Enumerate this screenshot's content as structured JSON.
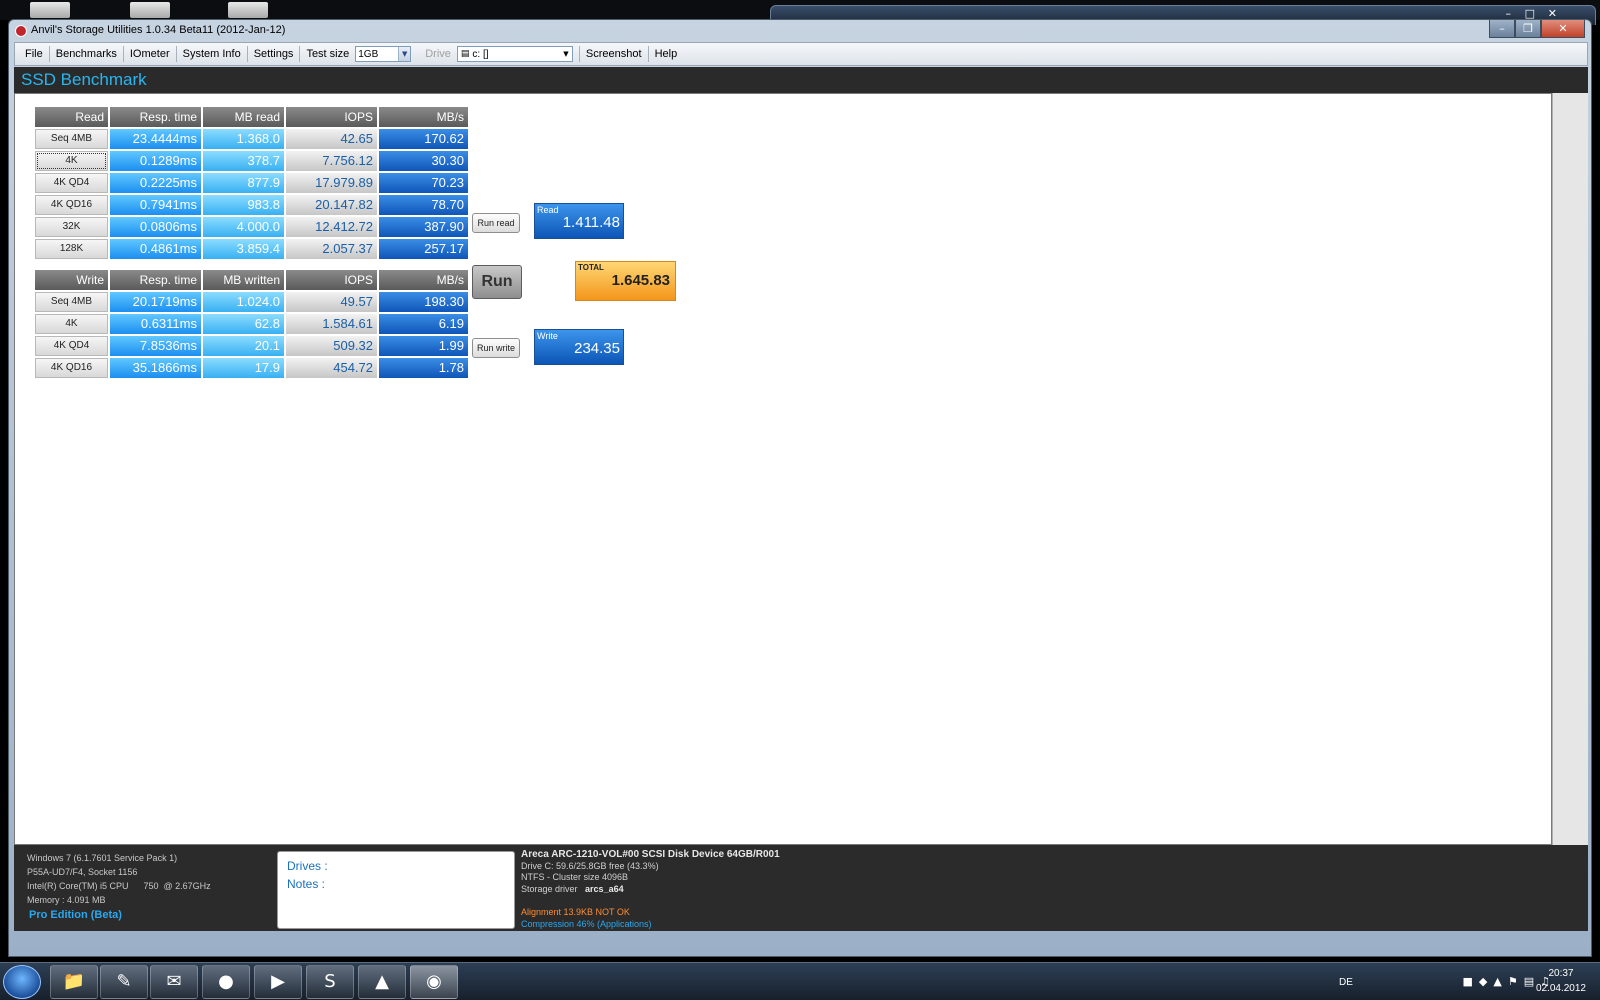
{
  "window": {
    "title": "Anvil's Storage Utilities 1.0.34 Beta11 (2012-Jan-12)"
  },
  "menu": {
    "items": [
      "File",
      "Benchmarks",
      "IOmeter",
      "System Info",
      "Settings"
    ],
    "test_size_label": "Test size",
    "test_size_value": "1GB",
    "drive_label": "Drive",
    "drive_value": "c: []",
    "screenshot": "Screenshot",
    "help": "Help"
  },
  "page_title": "SSD Benchmark",
  "read": {
    "headers": [
      "Read",
      "Resp. time",
      "MB read",
      "IOPS",
      "MB/s"
    ],
    "rows": [
      {
        "label": "Seq 4MB",
        "resp": "23.4444ms",
        "mb": "1.368.0",
        "iops": "42.65",
        "mbs": "170.62"
      },
      {
        "label": "4K",
        "resp": "0.1289ms",
        "mb": "378.7",
        "iops": "7.756.12",
        "mbs": "30.30"
      },
      {
        "label": "4K QD4",
        "resp": "0.2225ms",
        "mb": "877.9",
        "iops": "17.979.89",
        "mbs": "70.23"
      },
      {
        "label": "4K QD16",
        "resp": "0.7941ms",
        "mb": "983.8",
        "iops": "20.147.82",
        "mbs": "78.70"
      },
      {
        "label": "32K",
        "resp": "0.0806ms",
        "mb": "4.000.0",
        "iops": "12.412.72",
        "mbs": "387.90"
      },
      {
        "label": "128K",
        "resp": "0.4861ms",
        "mb": "3.859.4",
        "iops": "2.057.37",
        "mbs": "257.17"
      }
    ]
  },
  "write": {
    "headers": [
      "Write",
      "Resp. time",
      "MB written",
      "IOPS",
      "MB/s"
    ],
    "rows": [
      {
        "label": "Seq 4MB",
        "resp": "20.1719ms",
        "mb": "1.024.0",
        "iops": "49.57",
        "mbs": "198.30"
      },
      {
        "label": "4K",
        "resp": "0.6311ms",
        "mb": "62.8",
        "iops": "1.584.61",
        "mbs": "6.19"
      },
      {
        "label": "4K QD4",
        "resp": "7.8536ms",
        "mb": "20.1",
        "iops": "509.32",
        "mbs": "1.99"
      },
      {
        "label": "4K QD16",
        "resp": "35.1866ms",
        "mb": "17.9",
        "iops": "454.72",
        "mbs": "1.78"
      }
    ]
  },
  "buttons": {
    "run_read": "Run read",
    "run": "Run",
    "run_write": "Run write"
  },
  "scores": {
    "read_label": "Read",
    "read_value": "1.411.48",
    "total_label": "TOTAL",
    "total_value": "1.645.83",
    "write_label": "Write",
    "write_value": "234.35"
  },
  "system": {
    "os": "Windows 7 (6.1.7601 Service Pack 1)",
    "board": "P55A-UD7/F4, Socket 1156",
    "cpu": "Intel(R) Core(TM) i5 CPU      750  @ 2.67GHz",
    "memory": "Memory : 4.091 MB",
    "edition": "Pro Edition (Beta)"
  },
  "notes": {
    "drives": "Drives :",
    "notes": "Notes :"
  },
  "drive_info": {
    "name": "Areca ARC-1210-VOL#00 SCSI Disk Device 64GB/R001",
    "free": "Drive C: 59.6/25.8GB free (43.3%)",
    "fs": "NTFS - Cluster size 4096B",
    "driver_label": "Storage driver",
    "driver": "arcs_a64",
    "alignment": "Alignment 13.9KB NOT OK",
    "compression": "Compression 46% (Applications)"
  },
  "taskbar": {
    "lang": "DE",
    "time": "20:37",
    "date": "02.04.2012"
  },
  "colors": {
    "accent": "#29b6f0",
    "orange": "#f3961a",
    "blue": "#0f55b8"
  }
}
